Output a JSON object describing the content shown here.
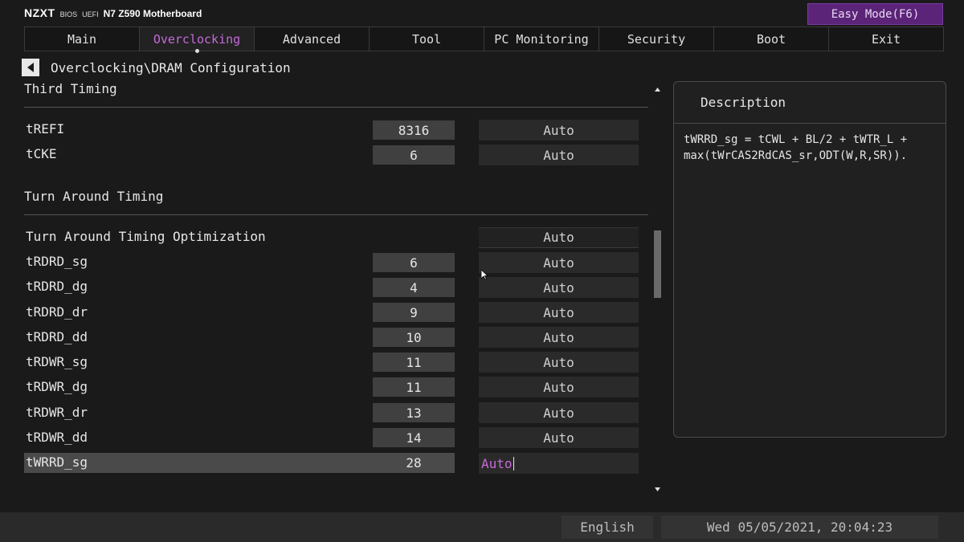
{
  "header": {
    "brand": "NZXT",
    "bios": "BIOS",
    "uefi": "UEFI",
    "model": "N7 Z590 Motherboard",
    "easy_mode": "Easy Mode(F6)"
  },
  "tabs": [
    "Main",
    "Overclocking",
    "Advanced",
    "Tool",
    "PC Monitoring",
    "Security",
    "Boot",
    "Exit"
  ],
  "active_tab": "Overclocking",
  "breadcrumb": "Overclocking\\DRAM Configuration",
  "sections": {
    "third_timing": "Third Timing",
    "turn_around": "Turn Around Timing"
  },
  "third_timing_rows": [
    {
      "label": "tREFI",
      "value": "8316",
      "setting": "Auto"
    },
    {
      "label": "tCKE",
      "value": "6",
      "setting": "Auto"
    }
  ],
  "tat_optimization": {
    "label": "Turn Around Timing Optimization",
    "setting": "Auto"
  },
  "turn_around_rows": [
    {
      "label": "tRDRD_sg",
      "value": "6",
      "setting": "Auto"
    },
    {
      "label": "tRDRD_dg",
      "value": "4",
      "setting": "Auto"
    },
    {
      "label": "tRDRD_dr",
      "value": "9",
      "setting": "Auto"
    },
    {
      "label": "tRDRD_dd",
      "value": "10",
      "setting": "Auto"
    },
    {
      "label": "tRDWR_sg",
      "value": "11",
      "setting": "Auto"
    },
    {
      "label": "tRDWR_dg",
      "value": "11",
      "setting": "Auto"
    },
    {
      "label": "tRDWR_dr",
      "value": "13",
      "setting": "Auto"
    },
    {
      "label": "tRDWR_dd",
      "value": "14",
      "setting": "Auto"
    }
  ],
  "selected_row": {
    "label": "tWRRD_sg",
    "value": "28",
    "setting": "Auto"
  },
  "description": {
    "title": "Description",
    "text": "tWRRD_sg = tCWL + BL/2 + tWTR_L +\nmax(tWrCAS2RdCAS_sr,ODT(W,R,SR))."
  },
  "footer": {
    "language": "English",
    "datetime": "Wed 05/05/2021, 20:04:23"
  },
  "colors": {
    "accent": "#c56ad8",
    "easy_mode_bg": "#5b2478",
    "background": "#1a1a1a"
  }
}
